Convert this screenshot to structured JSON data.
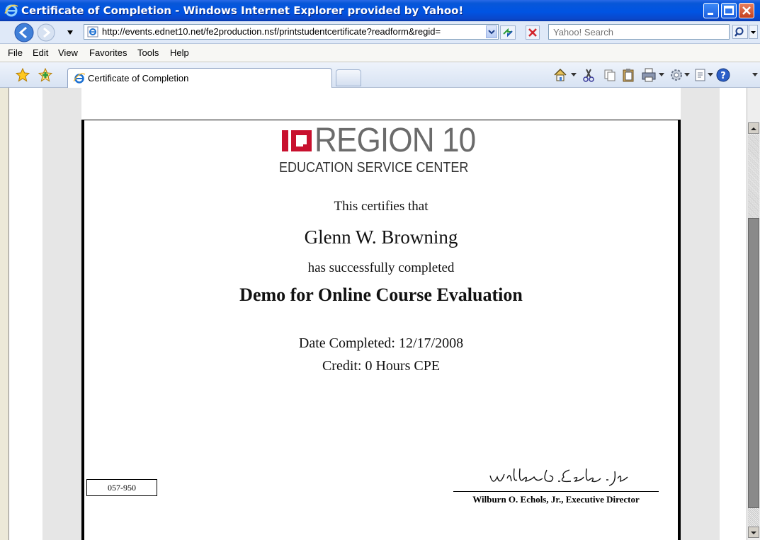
{
  "window": {
    "title": "Certificate of Completion - Windows Internet Explorer provided by Yahoo!",
    "icons": [
      "ie-logo-icon",
      "minimize-icon",
      "maximize-icon",
      "close-icon"
    ]
  },
  "address_bar": {
    "url": "http://events.ednet10.net/fe2production.nsf/printstudentcertificate?readform&regid=",
    "search_placeholder": "Yahoo! Search",
    "icons": [
      "back-icon",
      "forward-icon",
      "refresh-icon",
      "stop-icon",
      "search-icon"
    ]
  },
  "menu": {
    "items": [
      "File",
      "Edit",
      "View",
      "Favorites",
      "Tools",
      "Help"
    ]
  },
  "tabs": {
    "active_label": "Certificate of Completion",
    "toolbar_icons": [
      "home-icon",
      "cut-icon",
      "copy-icon",
      "paste-icon",
      "print-icon",
      "tools-gear-icon",
      "page-icon",
      "help-icon"
    ]
  },
  "certificate": {
    "logo_word": "REGION 10",
    "logo_sub": "EDUCATION SERVICE CENTER",
    "certifies": "This certifies that",
    "name": "Glenn W. Browning",
    "completed": "has successfully completed",
    "course": "Demo for Online Course Evaluation",
    "date_line": "Date Completed: 12/17/2008",
    "credit_line": "Credit: 0 Hours CPE",
    "cert_id": "057-950",
    "signatory": "Wilburn O. Echols, Jr., Executive Director"
  },
  "colors": {
    "titlebar_blue": "#0054e3",
    "logo_red": "#c8102e",
    "logo_gray": "#6b6b6b"
  }
}
